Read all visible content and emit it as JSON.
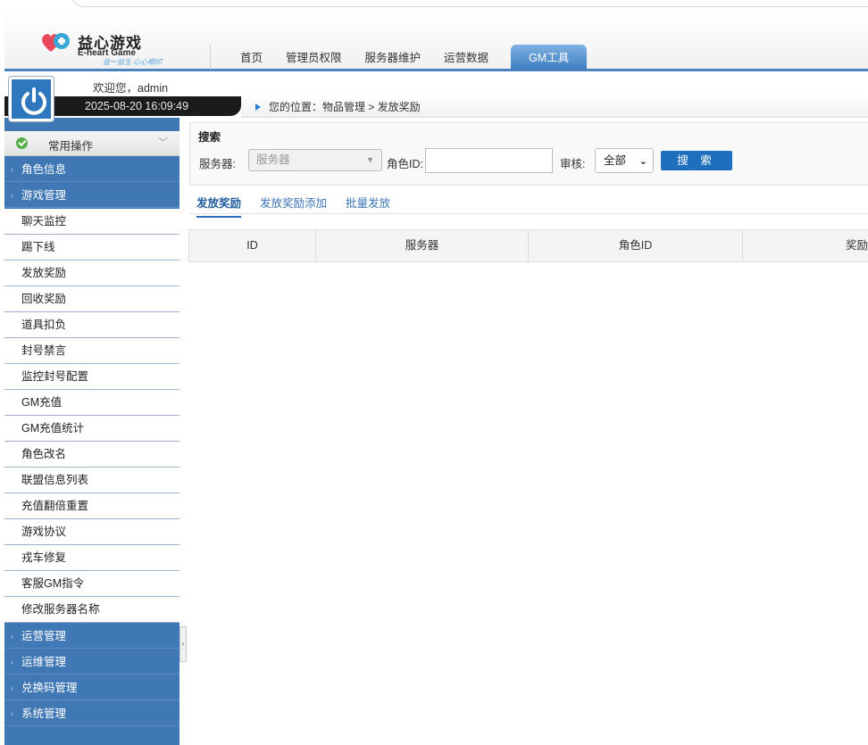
{
  "header": {
    "logo_title": "益心游戏",
    "logo_sub": "E-heart Game",
    "logo_slogan": "益一益生 心心相印",
    "nav": [
      {
        "label": "首页"
      },
      {
        "label": "管理员权限"
      },
      {
        "label": "服务器维护"
      },
      {
        "label": "运营数据"
      },
      {
        "label": "GM工具"
      }
    ],
    "active_nav": "GM工具"
  },
  "user": {
    "welcome": "欢迎您，admin",
    "datetime": "2025-08-20 16:09:49"
  },
  "breadcrumb": {
    "text": "您的位置：物品管理 > 发放奖励"
  },
  "sidebar": {
    "common": "常用操作",
    "sections_top": [
      {
        "label": "角色信息"
      },
      {
        "label": "游戏管理"
      }
    ],
    "items": [
      {
        "label": "聊天监控"
      },
      {
        "label": "踢下线"
      },
      {
        "label": "发放奖励"
      },
      {
        "label": "回收奖励"
      },
      {
        "label": "道具扣负"
      },
      {
        "label": "封号禁言"
      },
      {
        "label": "监控封号配置"
      },
      {
        "label": "GM充值"
      },
      {
        "label": "GM充值统计"
      },
      {
        "label": "角色改名"
      },
      {
        "label": "联盟信息列表"
      },
      {
        "label": "充值翻倍重置"
      },
      {
        "label": "游戏协议"
      },
      {
        "label": "戎车修复"
      },
      {
        "label": "客服GM指令"
      },
      {
        "label": "修改服务器名称"
      }
    ],
    "sections_bottom": [
      {
        "label": "运营管理"
      },
      {
        "label": "运维管理"
      },
      {
        "label": "兑换码管理"
      },
      {
        "label": "系统管理"
      }
    ]
  },
  "search": {
    "title": "搜索",
    "server_label": "服务器:",
    "server_placeholder": "服务器",
    "role_label": "角色ID:",
    "role_value": "",
    "audit_label": "审核:",
    "audit_value": "全部",
    "button": "搜 索"
  },
  "tabs": [
    {
      "label": "发放奖励"
    },
    {
      "label": "发放奖励添加"
    },
    {
      "label": "批量发放"
    }
  ],
  "table": {
    "columns": [
      "ID",
      "服务器",
      "角色ID",
      "奖励"
    ]
  },
  "colors": {
    "accent": "#3f78b4",
    "active_tab": "#3e7fc1",
    "button": "#1f6fbf"
  }
}
